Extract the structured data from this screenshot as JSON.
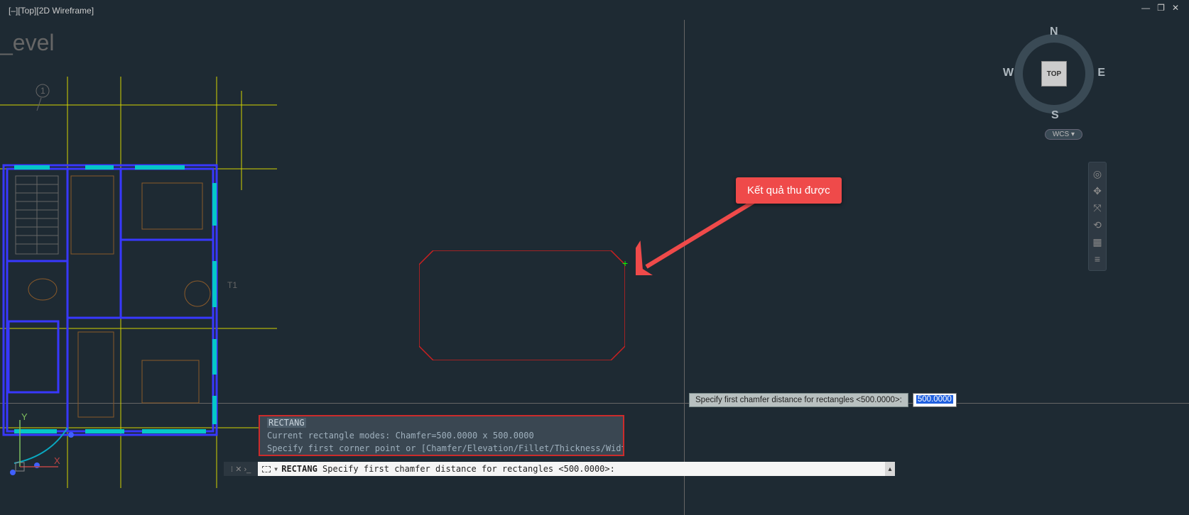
{
  "viewport_label": "[–][Top][2D Wireframe]",
  "window_controls": {
    "min": "—",
    "restore": "❐",
    "close": "✕"
  },
  "level_text": "_evel",
  "viewcube": {
    "n": "N",
    "s": "S",
    "w": "W",
    "e": "E",
    "face": "TOP"
  },
  "wcs": "WCS ▾",
  "callout_text": "Kết quả thu được",
  "cmd_history": {
    "l1": "RECTANG",
    "l2": "Current rectangle modes:  Chamfer=500.0000 x 500.0000",
    "l3": "Specify first corner point or [Chamfer/Elevation/Fillet/Thickness/Width]: c"
  },
  "cmd_input": {
    "cmd_name": "RECTANG",
    "prompt": "Specify first chamfer distance for rectangles <500.0000>:"
  },
  "dyn_input": {
    "prompt": "Specify first chamfer distance for rectangles <500.0000>:",
    "value": "500.0000"
  },
  "ucs_labels": {
    "x": "X",
    "y": "Y"
  },
  "grid_markers": {
    "m1": "1",
    "m2": "T1"
  }
}
